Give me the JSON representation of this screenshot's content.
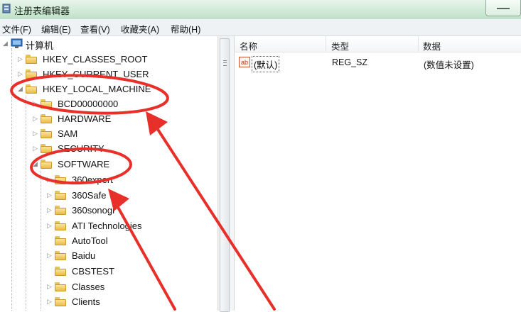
{
  "window": {
    "title": "注册表编辑器",
    "app_icon": "regedit-icon"
  },
  "menubar": {
    "items": [
      "文件(F)",
      "编辑(E)",
      "查看(V)",
      "收藏夹(A)",
      "帮助(H)"
    ]
  },
  "tree": {
    "root": "计算机",
    "nodes": [
      "HKEY_CLASSES_ROOT",
      "HKEY_CURRENT_USER",
      "HKEY_LOCAL_MACHINE",
      "BCD00000000",
      "HARDWARE",
      "SAM",
      "SECURITY",
      "SOFTWARE",
      "360expert",
      "360Safe",
      "360sonogr",
      "ATI Technologies",
      "AutoTool",
      "Baidu",
      "CBSTEST",
      "Classes",
      "Clients"
    ]
  },
  "list": {
    "columns": [
      "名称",
      "类型",
      "数据"
    ],
    "rows": [
      {
        "name": "(默认)",
        "type": "REG_SZ",
        "data": "(数值未设置)",
        "icon": "ab-string-icon"
      }
    ]
  },
  "annotations": {
    "color": "#e8302a"
  }
}
